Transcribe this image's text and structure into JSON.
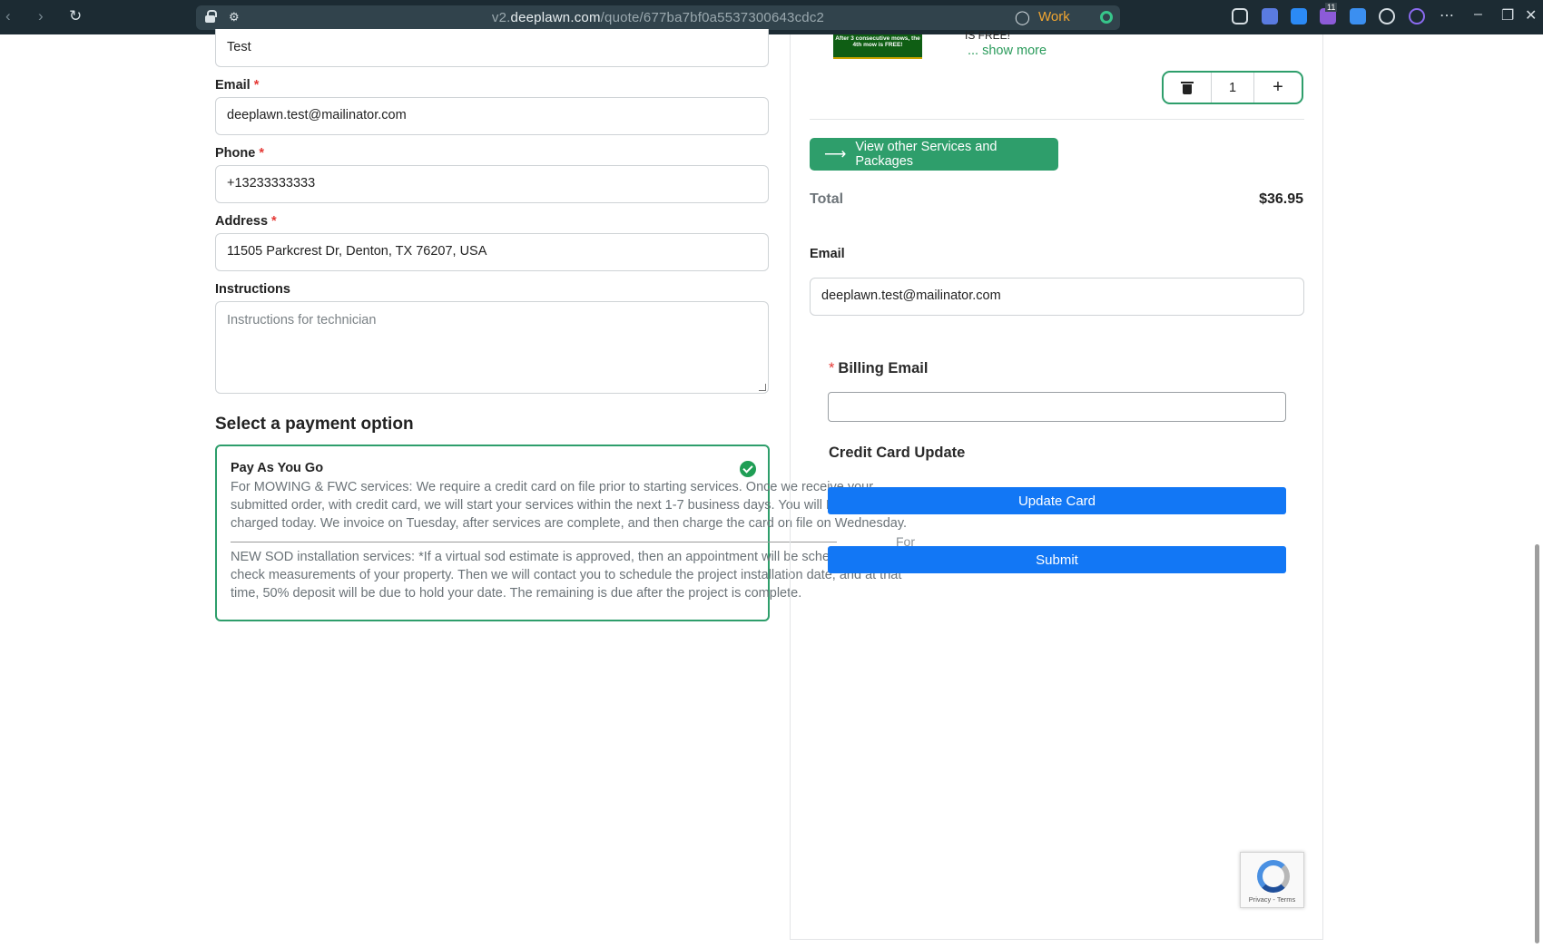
{
  "browser": {
    "url_prefix": "v2.",
    "url_host": "deeplawn.com",
    "url_path": "/quote/677ba7bf0a5537300643cdc2",
    "container_label": "Work",
    "extension_badge": "11"
  },
  "form": {
    "name_value": "Test",
    "email_label": "Email",
    "email_value": "deeplawn.test@mailinator.com",
    "phone_label": "Phone",
    "phone_value": "+13233333333",
    "address_label": "Address",
    "address_value": "11505 Parkcrest Dr, Denton, TX 76207, USA",
    "instructions_label": "Instructions",
    "instructions_placeholder": "Instructions for technician",
    "required_marker": "*"
  },
  "payment": {
    "section_title": "Select a payment option",
    "option_title": "Pay As You Go",
    "desc_mowing": "For MOWING & FWC services: We require a credit card on file prior to starting services. Once we receive your submitted order, with credit card, we will start your services within the next 1-7 business days. You will NOT be charged today. We invoice on Tuesday, after services are complete, and then charge the card on file on Wednesday.",
    "desc_sod": "NEW SOD installation services: *If a virtual sod estimate is approved, then an appointment will be scheduled to double check measurements of your property. Then we will contact you to schedule the project installation date, and at that time, 50% deposit will be due to hold your date. The remaining is due after the project is complete.",
    "for_label": "For"
  },
  "cart": {
    "thumb_text": "After 3 consecutive mows, the 4th mow is FREE!",
    "free_text": "IS FREE!",
    "show_more": "... show more",
    "quantity": "1",
    "view_other_label": "View other Services and Packages",
    "total_label": "Total",
    "total_value": "$36.95"
  },
  "billing": {
    "email_label": "Email",
    "email_value": "deeplawn.test@mailinator.com",
    "billing_email_label": "Billing Email",
    "billing_email_value": "",
    "cc_title": "Credit Card Update",
    "update_card_label": "Update Card",
    "submit_label": "Submit",
    "recaptcha_text": "Privacy - Terms"
  },
  "colors": {
    "accent_green": "#2e9e6b",
    "submit_blue": "#1277f5",
    "required_red": "#e53935"
  }
}
